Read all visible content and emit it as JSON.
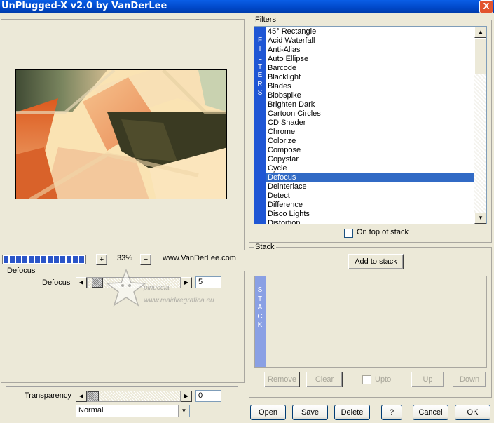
{
  "window": {
    "title": "UnPlugged-X v2.0 by VanDerLee",
    "close_label": "X"
  },
  "preview": {
    "progress_percent": 100,
    "zoom_plus": "+",
    "zoom_value": "33%",
    "zoom_minus": "−",
    "website": "www.VanDerLee.com"
  },
  "defocus": {
    "group_label": "Defocus",
    "param_label": "Defocus",
    "value": "5",
    "slider_fraction": 0.05
  },
  "transparency": {
    "label": "Transparency",
    "value": "0",
    "blend_mode": "Normal"
  },
  "filters": {
    "group_label": "Filters",
    "vertical_label": [
      "F",
      "I",
      "L",
      "T",
      "E",
      "R",
      "S"
    ],
    "items": [
      "45° Rectangle",
      "Acid Waterfall",
      "Anti-Alias",
      "Auto Ellipse",
      "Barcode",
      "Blacklight",
      "Blades",
      "Blobspike",
      "Brighten Dark",
      "Cartoon Circles",
      "CD Shader",
      "Chrome",
      "Colorize",
      "Compose",
      "Copystar",
      "Cycle",
      "Defocus",
      "Deinterlace",
      "Detect",
      "Difference",
      "Disco Lights",
      "Distortion"
    ],
    "selected": "Defocus",
    "on_top_label": "On top of stack"
  },
  "stack": {
    "group_label": "Stack",
    "add_label": "Add to stack",
    "vertical_label": [
      "S",
      "T",
      "A",
      "C",
      "K"
    ],
    "remove_label": "Remove",
    "clear_label": "Clear",
    "upto_label": "Upto",
    "up_label": "Up",
    "down_label": "Down"
  },
  "footer": {
    "open": "Open",
    "save": "Save",
    "delete": "Delete",
    "help": "?",
    "cancel": "Cancel",
    "ok": "OK"
  },
  "watermark": {
    "line1": "pinuccia",
    "line2": "www.maidiregrafica.eu"
  },
  "colors": {
    "title_bar": "#0047c8",
    "selection": "#316ac5",
    "sidebar": "#1f56d4",
    "face": "#ece9d8"
  }
}
